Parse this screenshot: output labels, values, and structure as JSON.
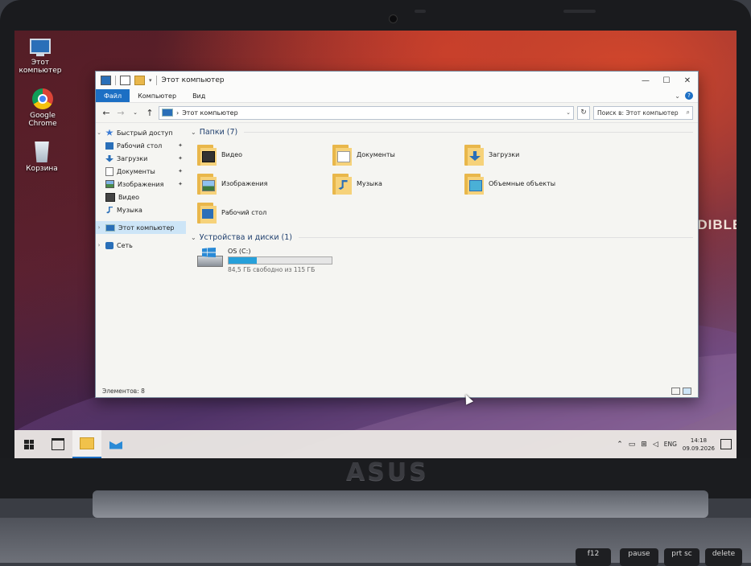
{
  "desktop": {
    "icons": [
      {
        "label": "Этот компьютер",
        "icon": "computer-icon"
      },
      {
        "label": "Google Chrome",
        "icon": "chrome-icon"
      },
      {
        "label": "Корзина",
        "icon": "recycle-bin-icon"
      }
    ],
    "wallpaper_text": "EDIBLE"
  },
  "window": {
    "title": "Этот компьютер",
    "minimize": "—",
    "maximize": "☐",
    "close": "✕",
    "ribbon_tabs": [
      "Файл",
      "Компьютер",
      "Вид"
    ],
    "help": "?",
    "collapse": "⌄",
    "address": {
      "back": "←",
      "forward": "→",
      "recent": "⌄",
      "up": "↑",
      "separator": "›",
      "path": "Этот компьютер",
      "dropdown": "⌄",
      "refresh": "↻"
    },
    "search": {
      "placeholder": "Поиск в: Этот компьютер",
      "icon": "⌕"
    },
    "nav": {
      "quick_access": "Быстрый доступ",
      "quick_items": [
        {
          "label": "Рабочий стол",
          "pinned": true,
          "icon": "desktop-icon"
        },
        {
          "label": "Загрузки",
          "pinned": true,
          "icon": "downloads-icon"
        },
        {
          "label": "Документы",
          "pinned": true,
          "icon": "documents-icon"
        },
        {
          "label": "Изображения",
          "pinned": true,
          "icon": "pictures-icon"
        },
        {
          "label": "Видео",
          "pinned": false,
          "icon": "videos-icon"
        },
        {
          "label": "Музыка",
          "pinned": false,
          "icon": "music-icon"
        }
      ],
      "this_pc": "Этот компьютер",
      "network": "Сеть",
      "expand": "›",
      "expanded": "⌄",
      "pin": "📌"
    },
    "folders_header": "Папки (7)",
    "folders": [
      {
        "label": "Видео",
        "icon": "videos-folder-icon"
      },
      {
        "label": "Документы",
        "icon": "documents-folder-icon"
      },
      {
        "label": "Загрузки",
        "icon": "downloads-folder-icon"
      },
      {
        "label": "Изображения",
        "icon": "pictures-folder-icon"
      },
      {
        "label": "Музыка",
        "icon": "music-folder-icon"
      },
      {
        "label": "Объемные объекты",
        "icon": "3d-objects-folder-icon"
      },
      {
        "label": "Рабочий стол",
        "icon": "desktop-folder-icon"
      }
    ],
    "devices_header": "Устройства и диски (1)",
    "drive": {
      "name": "OS (C:)",
      "free_text": "84,5 ГБ свободно из 115 ГБ",
      "used_fraction": 0.27
    },
    "status": "Элементов: 8"
  },
  "taskbar": {
    "lang": "ENG",
    "time": "14:18",
    "date": "09.09.2026",
    "tray_icons": [
      "chevron-up-icon",
      "battery-icon",
      "network-icon",
      "volume-icon"
    ]
  },
  "laptop": {
    "brand": "ASUS",
    "keys": [
      "f12",
      "pause",
      "prt sc",
      "delete"
    ]
  }
}
